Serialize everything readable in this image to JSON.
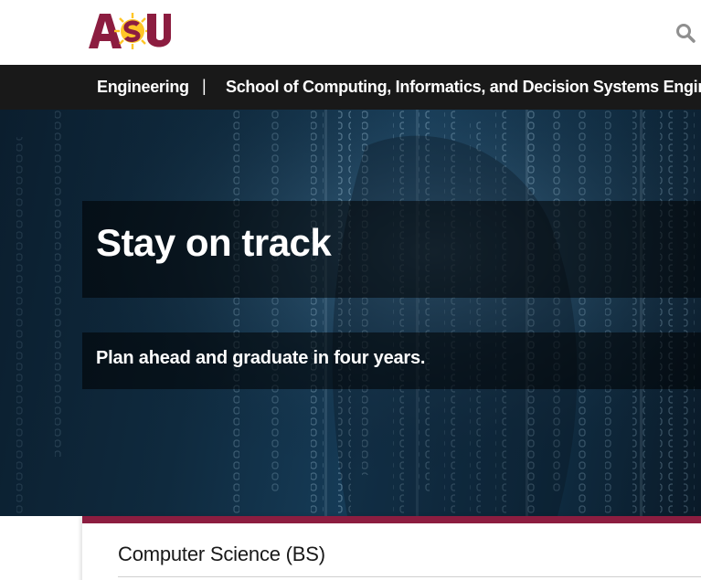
{
  "header": {
    "logo_text": "ASU",
    "search_icon": "search-icon"
  },
  "nav": {
    "crumbs": [
      {
        "label": "Engineering"
      },
      {
        "label": "School of Computing, Informatics, and Decision Systems Engineering"
      }
    ],
    "separator": "|"
  },
  "hero": {
    "title": "Stay on track",
    "subtitle": "Plan ahead and graduate in four years."
  },
  "card": {
    "program_title": "Computer Science (BS)"
  },
  "colors": {
    "maroon": "#8c1d40",
    "gold": "#ffc627",
    "nav_bg": "#191919"
  }
}
